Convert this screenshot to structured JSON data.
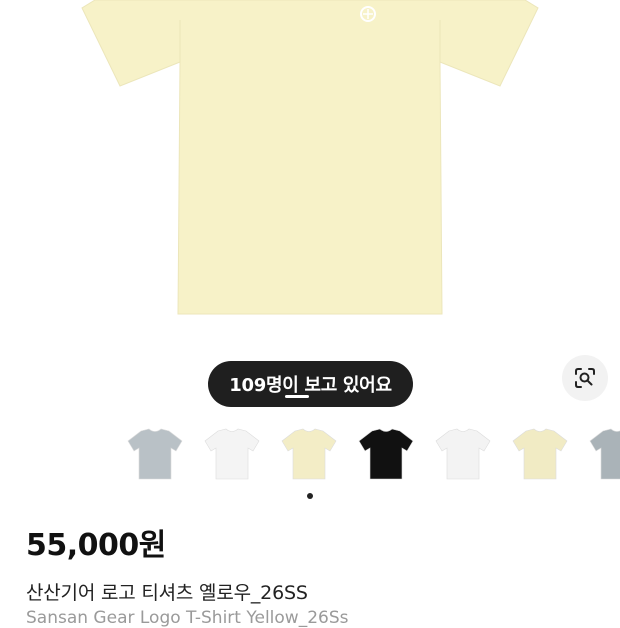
{
  "hero": {
    "image": "product-image-tshirt-yellow",
    "shirt_color": "#f7f2c8",
    "logo_color": "#ffffff"
  },
  "viewer_badge": {
    "text": "109명이 보고 있어요"
  },
  "lens_button": {
    "icon": "lens-search-icon"
  },
  "thumbnails": [
    {
      "name": "thumb-gray",
      "color": "#b9c1c6"
    },
    {
      "name": "thumb-white",
      "color": "#f4f4f4"
    },
    {
      "name": "thumb-yellow",
      "color": "#f3edc6"
    },
    {
      "name": "thumb-black",
      "color": "#111111"
    },
    {
      "name": "thumb-white-2",
      "color": "#f3f3f3"
    },
    {
      "name": "thumb-yellow-2",
      "color": "#f1ebc4"
    },
    {
      "name": "thumb-gray-2",
      "color": "#aab3b8"
    }
  ],
  "pagination": {
    "active_index": 0
  },
  "product": {
    "price": "55,000원",
    "title_ko": "산산기어 로고 티셔츠 옐로우_26SS",
    "title_en": "Sansan Gear Logo T-Shirt Yellow_26Ss"
  }
}
